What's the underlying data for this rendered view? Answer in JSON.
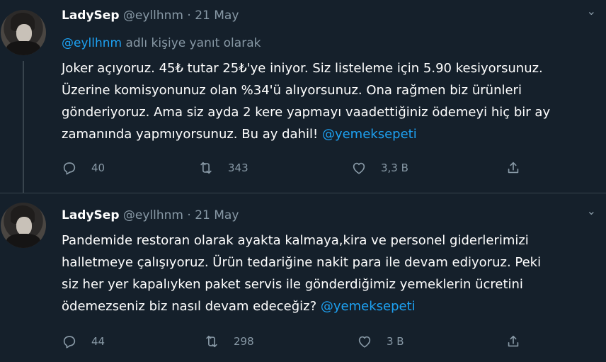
{
  "tweets": [
    {
      "name": "LadySep",
      "handle": "@eyllhnm",
      "separator": "·",
      "date": "21 May",
      "reply_mention": "@eyllhnm",
      "reply_suffix": " adlı kişiye yanıt olarak",
      "text": "Joker açıyoruz. 45₺ tutar 25₺'ye iniyor. Siz listeleme için 5.90 kesiyorsunuz.\nÜzerine komisyonunuz olan %34'ü alıyorsunuz. Ona rağmen biz ürünleri\ngönderiyoruz. Ama siz ayda 2 kere yapmayı vaadettiğiniz ödemeyi hiç bir ay\nzamanında yapmıyorsunuz. Bu ay dahil! ",
      "text_mention": "@yemeksepeti",
      "replies": "40",
      "retweets": "343",
      "likes": "3,3 B",
      "caret": "⌄"
    },
    {
      "name": "LadySep",
      "handle": "@eyllhnm",
      "separator": "·",
      "date": "21 May",
      "text": "Pandemide restoran olarak ayakta kalmaya,kira ve personel giderlerimizi\nhalletmeye çalışıyoruz. Ürün tedariğine nakit para ile devam ediyoruz. Peki\nsiz her yer kapalıyken paket servis ile gönderdiğimiz yemeklerin ücretini\nödemezseniz biz nasıl devam edeceğiz? ",
      "text_mention": "@yemeksepeti",
      "replies": "44",
      "retweets": "298",
      "likes": "3 B",
      "caret": "⌄"
    }
  ],
  "icons": {
    "reply": "reply-icon",
    "retweet": "retweet-icon",
    "like": "like-icon",
    "share": "share-icon"
  },
  "colors": {
    "background": "#15202b",
    "text": "#ffffff",
    "muted": "#8899a6",
    "link": "#1da1f2",
    "divider": "#38444d"
  }
}
